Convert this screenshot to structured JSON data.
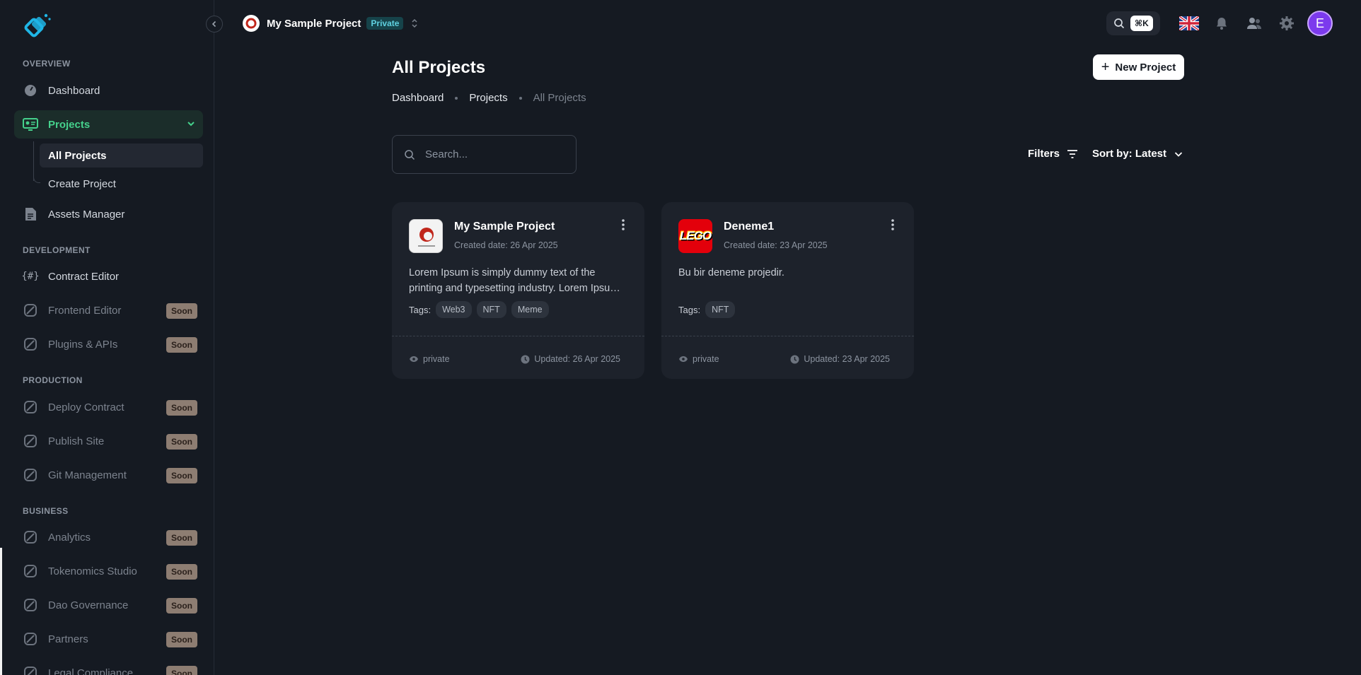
{
  "sidebar": {
    "sections": {
      "overview": "OVERVIEW",
      "development": "DEVELOPMENT",
      "production": "PRODUCTION",
      "business": "BUSINESS"
    },
    "items": {
      "dashboard": "Dashboard",
      "projects": "Projects",
      "all_projects": "All Projects",
      "create_project": "Create Project",
      "assets_manager": "Assets Manager",
      "contract_editor": "Contract Editor",
      "frontend_editor": "Frontend Editor",
      "plugins_apis": "Plugins & APIs",
      "deploy_contract": "Deploy Contract",
      "publish_site": "Publish Site",
      "git_management": "Git Management",
      "analytics": "Analytics",
      "tokenomics_studio": "Tokenomics Studio",
      "dao_governance": "Dao Governance",
      "partners": "Partners",
      "legal_compliance": "Legal Compliance"
    },
    "soon_label": "Soon",
    "accent_color": "#45d18c"
  },
  "topbar": {
    "project_name": "My Sample Project",
    "project_visibility": "Private",
    "shortcut": "⌘K",
    "user_initial": "E",
    "icons": [
      "search-icon",
      "uk-flag-icon",
      "bell-icon",
      "users-icon",
      "gear-icon"
    ]
  },
  "main": {
    "title": "All Projects",
    "new_project_label": "New Project",
    "breadcrumb": [
      "Dashboard",
      "Projects",
      "All Projects"
    ],
    "search_placeholder": "Search...",
    "filters_label": "Filters",
    "sort_label": "Sort by: Latest"
  },
  "projects": [
    {
      "name": "My Sample Project",
      "created": "Created date: 26 Apr 2025",
      "description": "Lorem Ipsum is simply dummy text of the printing and typesetting industry. Lorem Ipsum has been the industry's standard dummy text.",
      "tags_label": "Tags:",
      "tags": [
        "Web3",
        "NFT",
        "Meme"
      ],
      "visibility": "private",
      "updated": "Updated: 26 Apr 2025"
    },
    {
      "name": "Deneme1",
      "created": "Created date: 23 Apr 2025",
      "description": "Bu bir deneme projedir.",
      "tags_label": "Tags:",
      "tags": [
        "NFT"
      ],
      "visibility": "private",
      "updated": "Updated: 23 Apr 2025",
      "logo_text": "LEGO"
    }
  ]
}
